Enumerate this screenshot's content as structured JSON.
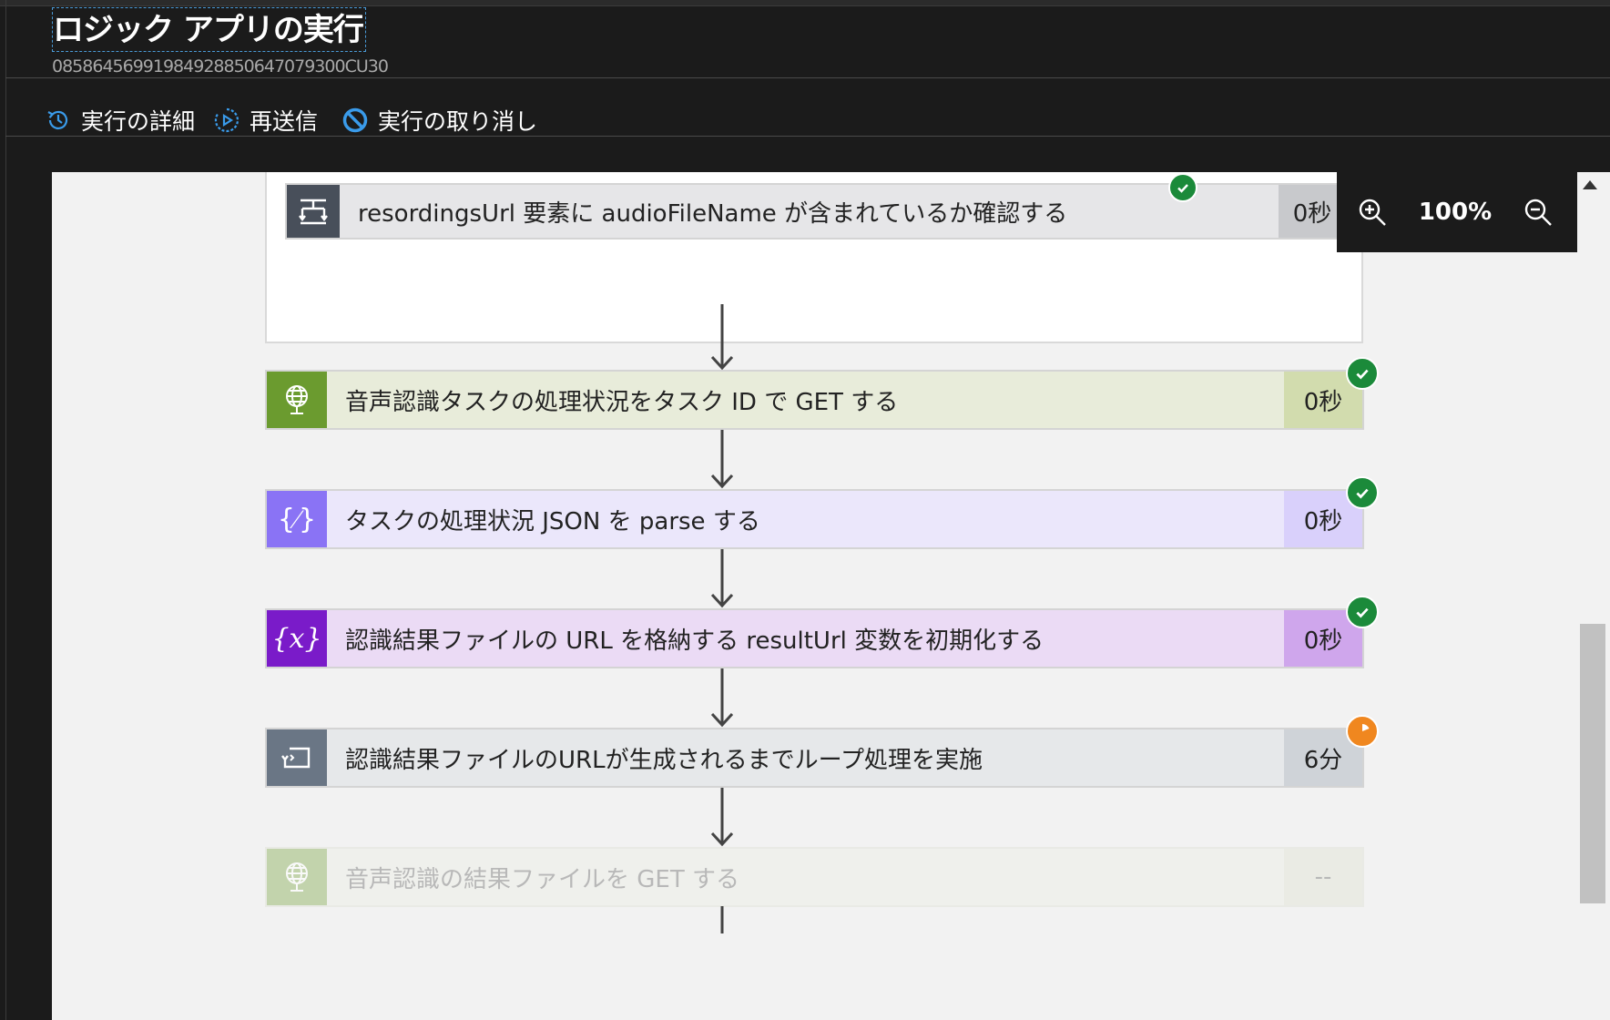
{
  "header": {
    "title": "ロジック アプリの実行",
    "run_id": "08586456991984928850647079300CU30"
  },
  "commands": [
    {
      "label": "実行の詳細",
      "icon": "history-icon"
    },
    {
      "label": "再送信",
      "icon": "resubmit-icon"
    },
    {
      "label": "実行の取り消し",
      "icon": "cancel-icon"
    }
  ],
  "zoom": {
    "level": "100%"
  },
  "steps": [
    {
      "label": "resordingsUrl 要素に audioFileName が含まれているか確認する",
      "duration": "0秒",
      "status": "succeeded",
      "icon": "condition-icon"
    },
    {
      "label": "音声認識タスクの処理状況をタスク ID で GET する",
      "duration": "0秒",
      "status": "succeeded",
      "icon": "http-globe-icon"
    },
    {
      "label": "タスクの処理状況 JSON を parse する",
      "duration": "0秒",
      "status": "succeeded",
      "icon": "data-operations-icon"
    },
    {
      "label": "認識結果ファイルの URL を格納する resultUrl 変数を初期化する",
      "duration": "0秒",
      "status": "succeeded",
      "icon": "variable-icon"
    },
    {
      "label": "認識結果ファイルのURLが生成されるまでループ処理を実施",
      "duration": "6分",
      "status": "running",
      "icon": "until-loop-icon"
    },
    {
      "label": "音声認識の結果ファイルを GET する",
      "duration": "--",
      "status": "pending",
      "icon": "http-globe-icon"
    }
  ],
  "colors": {
    "succeeded": "#1b8a3a",
    "running": "#f0871f",
    "http": "#6b9b2f",
    "parse": "#8a73f5",
    "variable": "#7a1bc9",
    "control": "#6a7685"
  }
}
